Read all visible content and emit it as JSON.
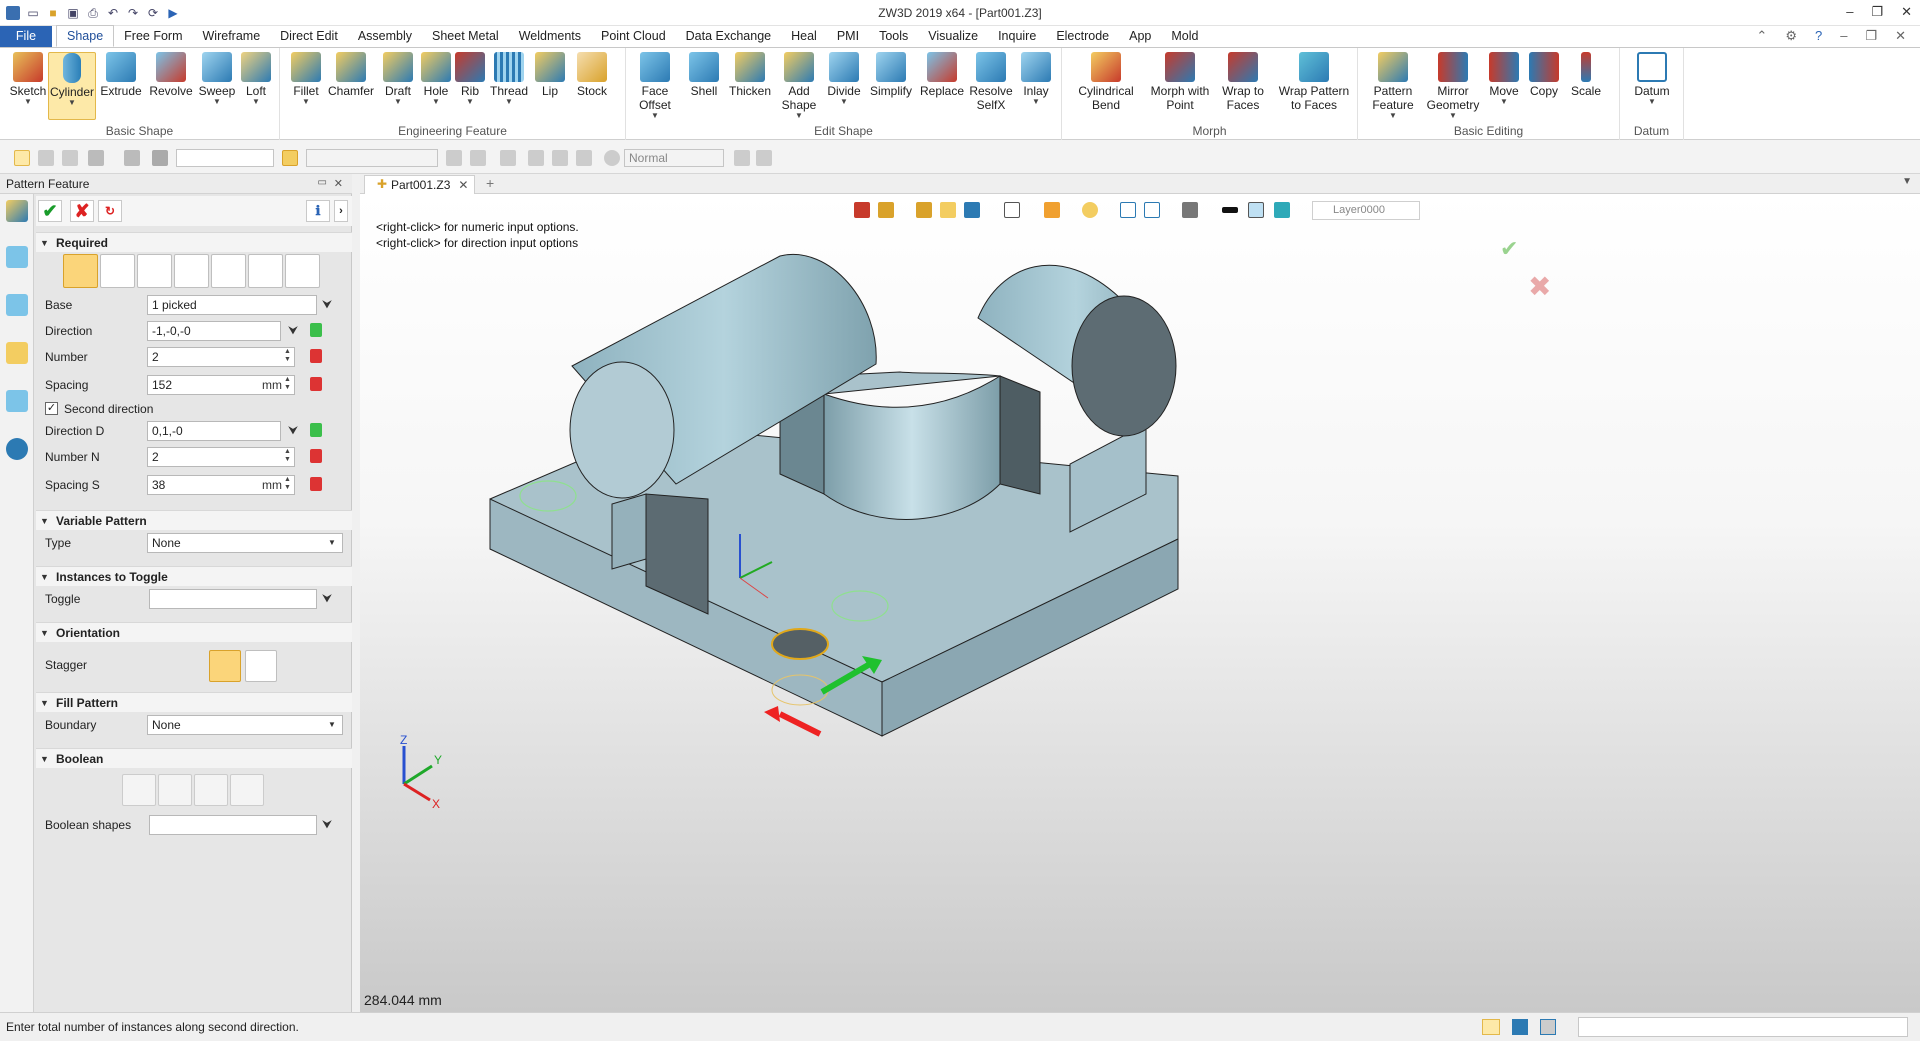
{
  "window": {
    "title": "ZW3D 2019  x64 - [Part001.Z3]"
  },
  "menu": {
    "file": "File",
    "tabs": [
      "Shape",
      "Free Form",
      "Wireframe",
      "Direct Edit",
      "Assembly",
      "Sheet Metal",
      "Weldments",
      "Point Cloud",
      "Data Exchange",
      "Heal",
      "PMI",
      "Tools",
      "Visualize",
      "Inquire",
      "Electrode",
      "App",
      "Mold"
    ],
    "active": "Shape"
  },
  "ribbon": {
    "groups": {
      "basic_shape": "Basic Shape",
      "engineering_feature": "Engineering Feature",
      "edit_shape": "Edit Shape",
      "morph": "Morph",
      "basic_editing": "Basic Editing",
      "datum": "Datum"
    },
    "tools": {
      "sketch": "Sketch",
      "cylinder": "Cylinder",
      "extrude": "Extrude",
      "revolve": "Revolve",
      "sweep": "Sweep",
      "loft": "Loft",
      "fillet": "Fillet",
      "chamfer": "Chamfer",
      "draft": "Draft",
      "hole": "Hole",
      "rib": "Rib",
      "thread": "Thread",
      "lip": "Lip",
      "stock": "Stock",
      "face_offset": "Face Offset",
      "shell": "Shell",
      "thicken": "Thicken",
      "add_shape": "Add Shape",
      "divide": "Divide",
      "simplify": "Simplify",
      "replace": "Replace",
      "resolve_selfx": "Resolve SelfX",
      "inlay": "Inlay",
      "cylindrical_bend": "Cylindrical Bend",
      "morph_with_point": "Morph with Point",
      "wrap_to_faces": "Wrap to Faces",
      "wrap_pattern": "Wrap Pattern to Faces",
      "pattern_feature": "Pattern Feature",
      "mirror_geometry": "Mirror Geometry",
      "move": "Move",
      "copy": "Copy",
      "scale": "Scale",
      "datum": "Datum"
    }
  },
  "toolbar2": {
    "render_mode": "Normal"
  },
  "panel": {
    "title": "Pattern Feature",
    "required": {
      "header": "Required",
      "base_label": "Base",
      "base_value": "1 picked",
      "direction_label": "Direction",
      "direction_value": "-1,-0,-0",
      "number_label": "Number",
      "number_value": "2",
      "spacing_label": "Spacing",
      "spacing_value": "152",
      "spacing_unit": "mm",
      "second_direction_label": "Second direction",
      "direction_d_label": "Direction  D",
      "direction_d_value": "0,1,-0",
      "number_n_label": "Number  N",
      "number_n_value": "2",
      "spacing_s_label": "Spacing  S",
      "spacing_s_value": "38",
      "spacing_s_unit": "mm"
    },
    "variable": {
      "header": "Variable Pattern",
      "type_label": "Type",
      "type_value": "None"
    },
    "toggle": {
      "header": "Instances to Toggle",
      "toggle_label": "Toggle"
    },
    "orientation": {
      "header": "Orientation",
      "stagger_label": "Stagger"
    },
    "fill": {
      "header": "Fill Pattern",
      "boundary_label": "Boundary",
      "boundary_value": "None"
    },
    "boolean": {
      "header": "Boolean",
      "shapes_label": "Boolean shapes"
    }
  },
  "document": {
    "tab": "Part001.Z3"
  },
  "viewport": {
    "hint1": "<right-click> for numeric input options.",
    "hint2": "<right-click> for direction input options",
    "layer": "Layer0000",
    "measure": "284.044 mm",
    "triad": {
      "x": "X",
      "y": "Y",
      "z": "Z"
    }
  },
  "status": {
    "message": "Enter total number of instances along second direction."
  }
}
